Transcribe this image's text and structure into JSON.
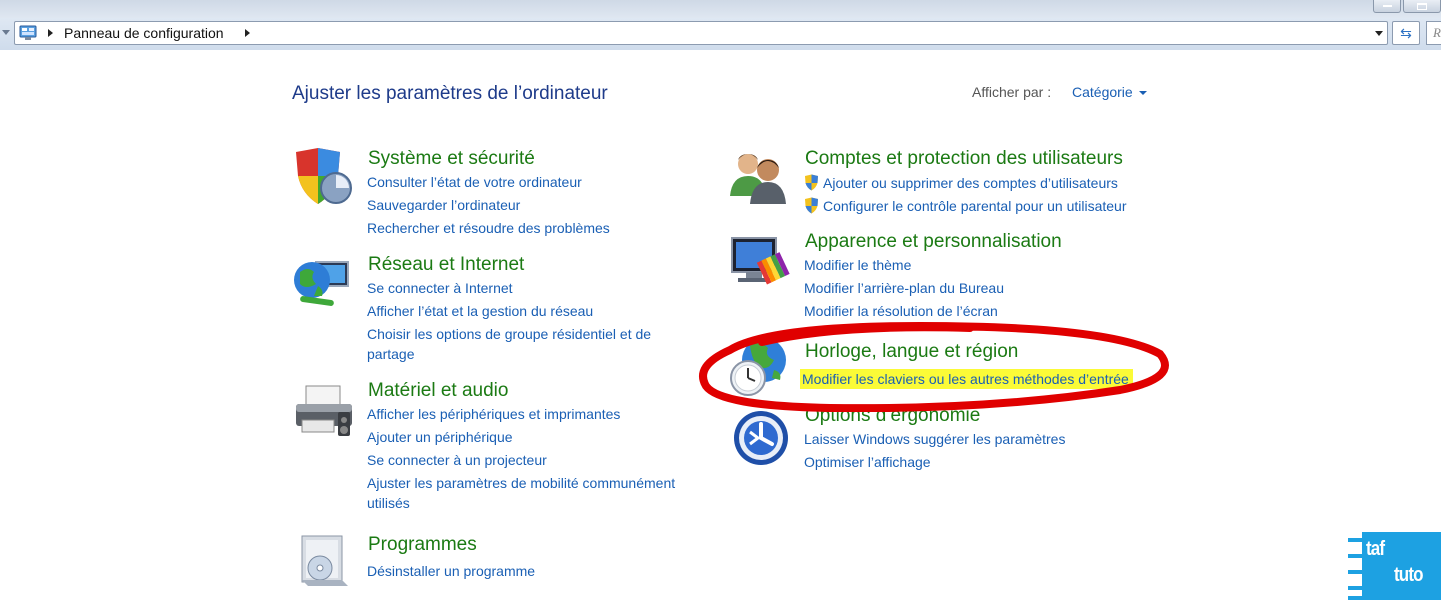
{
  "address": {
    "location": "Panneau de configuration",
    "search_placeholder": "R"
  },
  "header": {
    "title": "Ajuster les paramètres de l’ordinateur",
    "view_by_label": "Afficher par :",
    "view_by_value": "Catégorie"
  },
  "categories": {
    "system": {
      "title": "Système et sécurité",
      "links": [
        "Consulter l’état de votre ordinateur",
        "Sauvegarder l’ordinateur",
        "Rechercher et résoudre des problèmes"
      ]
    },
    "network": {
      "title": "Réseau et Internet",
      "links": [
        "Se connecter à Internet",
        "Afficher l’état et la gestion du réseau",
        "Choisir les options de groupe résidentiel et de",
        "partage"
      ]
    },
    "hardware": {
      "title": "Matériel et audio",
      "links": [
        "Afficher les périphériques et imprimantes",
        "Ajouter un périphérique",
        "Se connecter à un projecteur",
        "Ajuster les paramètres de mobilité communément",
        "utilisés"
      ]
    },
    "programs": {
      "title": "Programmes",
      "links": [
        "Désinstaller un programme"
      ]
    },
    "accounts": {
      "title": "Comptes et protection des utilisateurs",
      "links": [
        "Ajouter ou supprimer des comptes d’utilisateurs",
        "Configurer le contrôle parental pour un utilisateur"
      ]
    },
    "appearance": {
      "title": "Apparence et personnalisation",
      "links": [
        "Modifier le thème",
        "Modifier l’arrière-plan du Bureau",
        "Modifier la résolution de l’écran"
      ]
    },
    "clock": {
      "title": "Horloge, langue et région",
      "links": [
        "Modifier les claviers ou les autres méthodes d’entrée"
      ]
    },
    "ease": {
      "title": "Options d’ergonomie",
      "links": [
        "Laisser Windows suggérer les paramètres",
        "Optimiser l’affichage"
      ]
    }
  },
  "watermark": {
    "line1": "taf",
    "line2": "tuto"
  },
  "colors": {
    "title_green": "#1b7a13",
    "link_blue": "#1a5fb4",
    "highlight_yellow": "#fbfb37",
    "annotation_red": "#e00000"
  }
}
